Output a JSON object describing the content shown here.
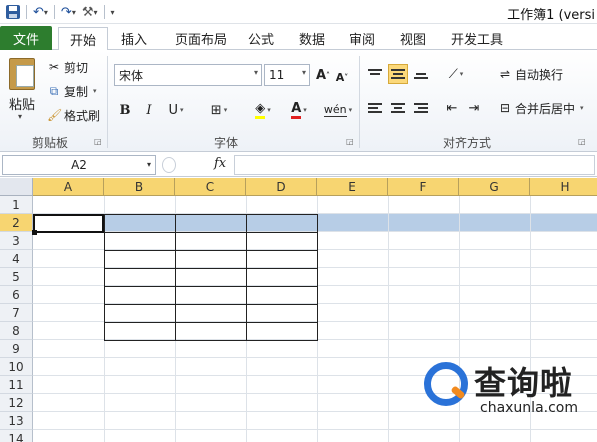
{
  "window": {
    "title": "工作簿1 (versi"
  },
  "tabs": [
    {
      "label": "文件"
    },
    {
      "label": "开始"
    },
    {
      "label": "插入"
    },
    {
      "label": "页面布局"
    },
    {
      "label": "公式"
    },
    {
      "label": "数据"
    },
    {
      "label": "审阅"
    },
    {
      "label": "视图"
    },
    {
      "label": "开发工具"
    }
  ],
  "clipboard": {
    "paste": "粘贴",
    "cut": "剪切",
    "copy": "复制",
    "format_painter": "格式刷",
    "group": "剪贴板"
  },
  "font": {
    "name": "宋体",
    "size": "11",
    "group": "字体",
    "bold": "B",
    "italic": "I",
    "underline": "U",
    "grow": "A",
    "shrink": "A",
    "font_color": "A",
    "phonetic": "wén"
  },
  "alignment": {
    "wrap_text": "自动换行",
    "merge_center": "合并后居中",
    "group": "对齐方式"
  },
  "formula_bar": {
    "name_box": "A2",
    "fx": "fx",
    "value": ""
  },
  "sheet": {
    "columns": [
      "A",
      "B",
      "C",
      "D",
      "E",
      "F",
      "G",
      "H"
    ],
    "rows": [
      "1",
      "2",
      "3",
      "4",
      "5",
      "6",
      "7",
      "8",
      "9",
      "10",
      "11",
      "12",
      "13",
      "14"
    ],
    "selected_row": "2",
    "active_cell": "A2"
  },
  "watermark": {
    "title": "查询啦",
    "url": "chaxunla.com"
  },
  "colors": {
    "file_tab": "#2d7d2e",
    "header_selected": "#f7d571",
    "row_selection": "#b7cde6",
    "align_active": "#fbd87a",
    "logo_blue": "#2a72d8",
    "logo_orange": "#f28a1e"
  }
}
